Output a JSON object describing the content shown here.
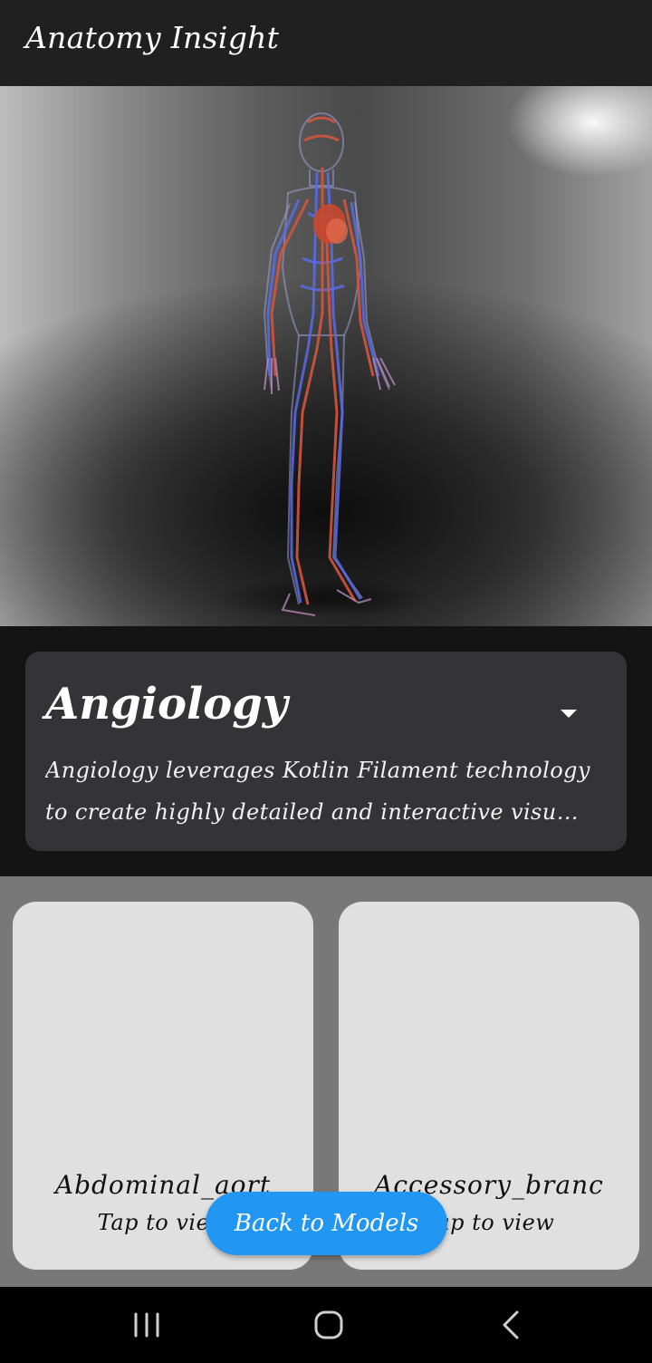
{
  "app_bar": {
    "title": "Anatomy Insight"
  },
  "viewer": {
    "model_icon": "human-circulatory-system-model"
  },
  "info_card": {
    "title": "Angiology",
    "description": "Angiology leverages Kotlin Filament technology to create highly detailed and interactive visu…",
    "dropdown_icon": "caret-down-icon"
  },
  "models": [
    {
      "name": "Abdominal_aort",
      "action": "Tap to view"
    },
    {
      "name": "Accessory_branc",
      "action": "Tap to view"
    }
  ],
  "back_button": {
    "label": "Back to Models"
  },
  "nav_bar": {
    "recents_icon": "recents-icon",
    "home_icon": "home-icon",
    "back_icon": "back-icon"
  },
  "colors": {
    "accent": "#2196f3",
    "app_bar": "#202020",
    "card_bg": "#333338",
    "model_card_bg": "#e0e0e0",
    "grid_bg": "#787878"
  }
}
